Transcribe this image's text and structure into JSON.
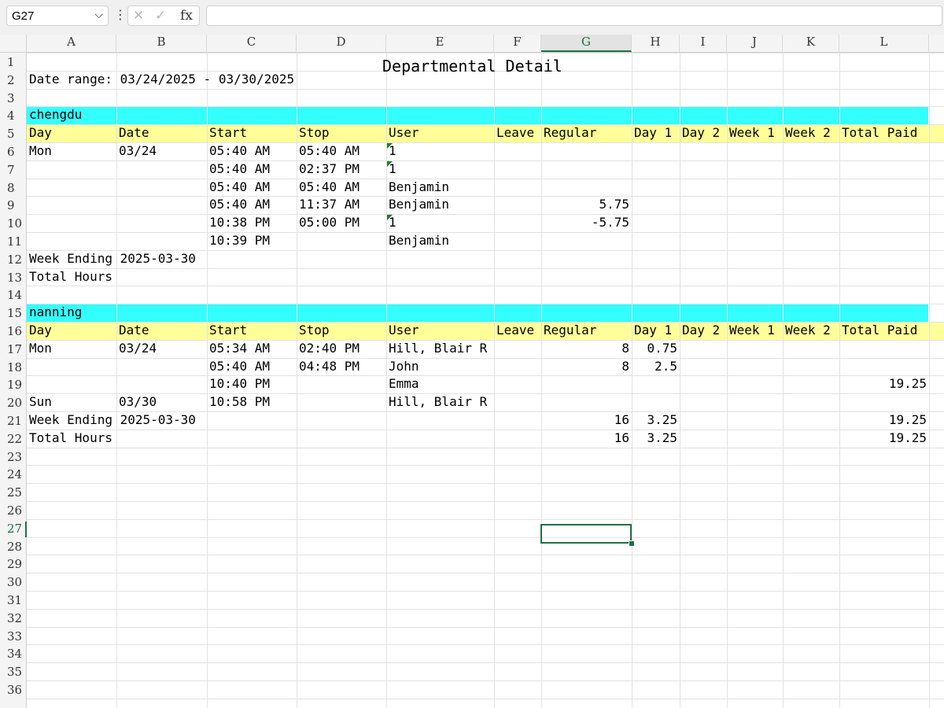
{
  "formula_bar": {
    "name_box": "G27",
    "formula": ""
  },
  "columns": [
    "A",
    "B",
    "C",
    "D",
    "E",
    "F",
    "G",
    "H",
    "I",
    "J",
    "K",
    "L"
  ],
  "selected_column": "G",
  "selected_row": "27",
  "row_numbers": [
    "1",
    "2",
    "3",
    "4",
    "5",
    "6",
    "7",
    "8",
    "9",
    "10",
    "11",
    "12",
    "13",
    "14",
    "15",
    "16",
    "17",
    "18",
    "19",
    "20",
    "21",
    "22",
    "23",
    "24",
    "25",
    "26",
    "27",
    "28",
    "29",
    "30",
    "31",
    "32",
    "33",
    "34",
    "35",
    "36"
  ],
  "sheet": {
    "title": "Departmental Detail",
    "date_range": "Date range: 03/24/2025 - 03/30/2025",
    "headers": [
      "Day",
      "Date",
      "Start",
      "Stop",
      "User",
      "Leave",
      "Regular",
      "Day 1",
      "Day 2",
      "Week 1",
      "Week 2",
      "Total Paid"
    ],
    "groups": [
      {
        "name": "chengdu",
        "rows": [
          {
            "day": "Mon",
            "date": "03/24",
            "start": "05:40 AM",
            "stop": "05:40 AM",
            "user": "1",
            "regular": "",
            "day1": "",
            "total": ""
          },
          {
            "day": "",
            "date": "",
            "start": "05:40 AM",
            "stop": "02:37 PM",
            "user": "1",
            "regular": "",
            "day1": "",
            "total": ""
          },
          {
            "day": "",
            "date": "",
            "start": "05:40 AM",
            "stop": "05:40 AM",
            "user": "Benjamin",
            "regular": "",
            "day1": "",
            "total": ""
          },
          {
            "day": "",
            "date": "",
            "start": "05:40 AM",
            "stop": "11:37 AM",
            "user": "Benjamin",
            "regular": "5.75",
            "day1": "",
            "total": ""
          },
          {
            "day": "",
            "date": "",
            "start": "10:38 PM",
            "stop": "05:00 PM",
            "user": "1",
            "regular": "-5.75",
            "day1": "",
            "total": ""
          },
          {
            "day": "",
            "date": "",
            "start": "10:39 PM",
            "stop": "",
            "user": "Benjamin",
            "regular": "",
            "day1": "",
            "total": ""
          }
        ],
        "week_ending": {
          "label": "Week Ending 2025-03-30",
          "regular": "",
          "day1": "",
          "total": ""
        },
        "total_hours": {
          "label": "Total Hours",
          "regular": "",
          "day1": "",
          "total": ""
        }
      },
      {
        "name": "nanning",
        "rows": [
          {
            "day": "Mon",
            "date": "03/24",
            "start": "05:34 AM",
            "stop": "02:40 PM",
            "user": "Hill, Blair R",
            "regular": "8",
            "day1": "0.75",
            "total": ""
          },
          {
            "day": "",
            "date": "",
            "start": "05:40 AM",
            "stop": "04:48 PM",
            "user": "John",
            "regular": "8",
            "day1": "2.5",
            "total": ""
          },
          {
            "day": "",
            "date": "",
            "start": "10:40 PM",
            "stop": "",
            "user": "Emma",
            "regular": "",
            "day1": "",
            "total": "19.25"
          },
          {
            "day": "Sun",
            "date": "03/30",
            "start": "10:58 PM",
            "stop": "",
            "user": "Hill, Blair R",
            "regular": "",
            "day1": "",
            "total": ""
          }
        ],
        "week_ending": {
          "label": "Week Ending 2025-03-30",
          "regular": "16",
          "day1": "3.25",
          "total": "19.25"
        },
        "total_hours": {
          "label": "Total Hours",
          "regular": "16",
          "day1": "3.25",
          "total": "19.25"
        }
      }
    ]
  },
  "colors": {
    "group_band": "#33ffff",
    "header_band": "#ffff99",
    "selection": "#1e7145",
    "comment_marker": "#1e7b2a"
  },
  "icons": [
    "chevron-down-icon",
    "more-vertical-icon",
    "cancel-icon",
    "confirm-icon",
    "fx-icon"
  ]
}
